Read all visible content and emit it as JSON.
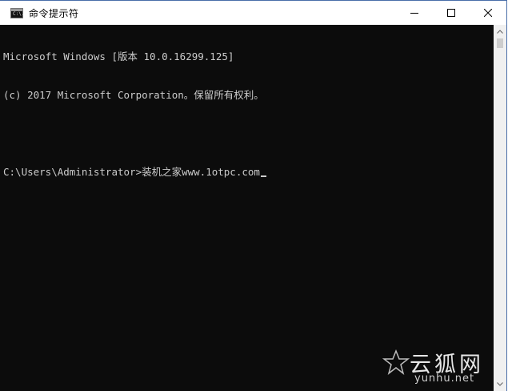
{
  "window": {
    "title": "命令提示符",
    "icon_label": "C:\\."
  },
  "controls": {
    "minimize": "minimize-icon",
    "maximize": "maximize-icon",
    "close": "close-icon"
  },
  "console": {
    "lines": [
      "Microsoft Windows [版本 10.0.16299.125]",
      "(c) 2017 Microsoft Corporation。保留所有权利。",
      "",
      "C:\\Users\\Administrator>装机之家www.1otpc.com"
    ]
  },
  "watermark": {
    "chinese": "云狐网",
    "latin": "yunhu.net"
  },
  "colors": {
    "console_bg": "#0c0c0c",
    "console_fg": "#cccccc",
    "titlebar_bg": "#ffffff",
    "border": "#4a6ea9"
  }
}
